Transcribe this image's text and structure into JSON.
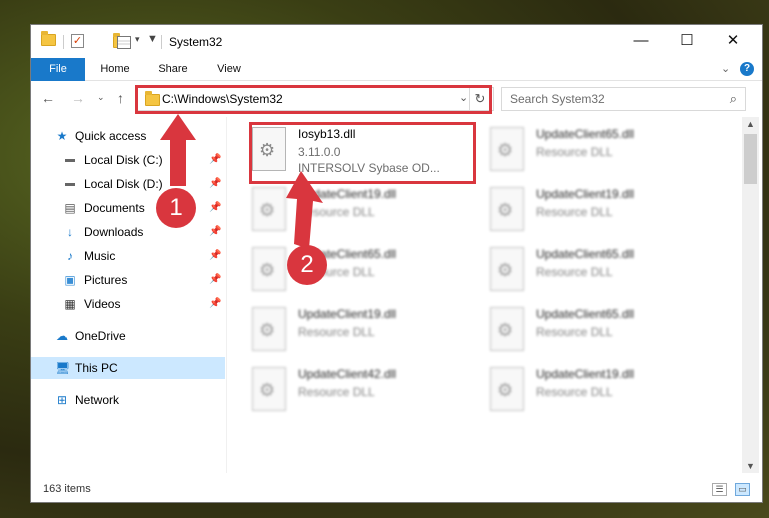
{
  "titlebar": {
    "title": "System32",
    "minimize_glyph": "—",
    "maximize_glyph": "☐",
    "close_glyph": "✕"
  },
  "ribbon": {
    "tabs": [
      "File",
      "Home",
      "Share",
      "View"
    ],
    "help_glyph": "?"
  },
  "nav": {
    "address": "C:\\Windows\\System32",
    "search_placeholder": "Search System32"
  },
  "sidebar": {
    "items": [
      {
        "label": "Quick access",
        "icon": "star-icon"
      },
      {
        "label": "Local Disk (C:)",
        "icon": "drive-icon"
      },
      {
        "label": "Local Disk (D:)",
        "icon": "drive-icon"
      },
      {
        "label": "Documents",
        "icon": "document-icon"
      },
      {
        "label": "Downloads",
        "icon": "download-icon"
      },
      {
        "label": "Music",
        "icon": "music-icon"
      },
      {
        "label": "Pictures",
        "icon": "pictures-icon"
      },
      {
        "label": "Videos",
        "icon": "video-icon"
      },
      {
        "label": "OneDrive",
        "icon": "cloud-icon"
      },
      {
        "label": "This PC",
        "icon": "computer-icon"
      },
      {
        "label": "Network",
        "icon": "network-icon"
      }
    ]
  },
  "files": {
    "highlighted": {
      "name": "Iosyb13.dll",
      "version": "3.11.0.0",
      "description": "INTERSOLV Sybase OD..."
    },
    "left_column": [
      {
        "name": "UpdateClient19.dll",
        "type": "Resource DLL"
      },
      {
        "name": "UpdateClient65.dll",
        "type": "Resource DLL"
      },
      {
        "name": "UpdateClient19.dll",
        "type": "Resource DLL"
      },
      {
        "name": "UpdateClient42.dll",
        "type": "Resource DLL"
      }
    ],
    "right_column": [
      {
        "name": "UpdateClient65.dll",
        "type": "Resource DLL"
      },
      {
        "name": "UpdateClient19.dll",
        "type": "Resource DLL"
      },
      {
        "name": "UpdateClient65.dll",
        "type": "Resource DLL"
      },
      {
        "name": "UpdateClient65.dll",
        "type": "Resource DLL"
      },
      {
        "name": "UpdateClient19.dll",
        "type": "Resource DLL"
      }
    ]
  },
  "status": {
    "item_count": "163 items"
  },
  "annotations": {
    "step1": "1",
    "step2": "2",
    "color": "#d9363e"
  }
}
